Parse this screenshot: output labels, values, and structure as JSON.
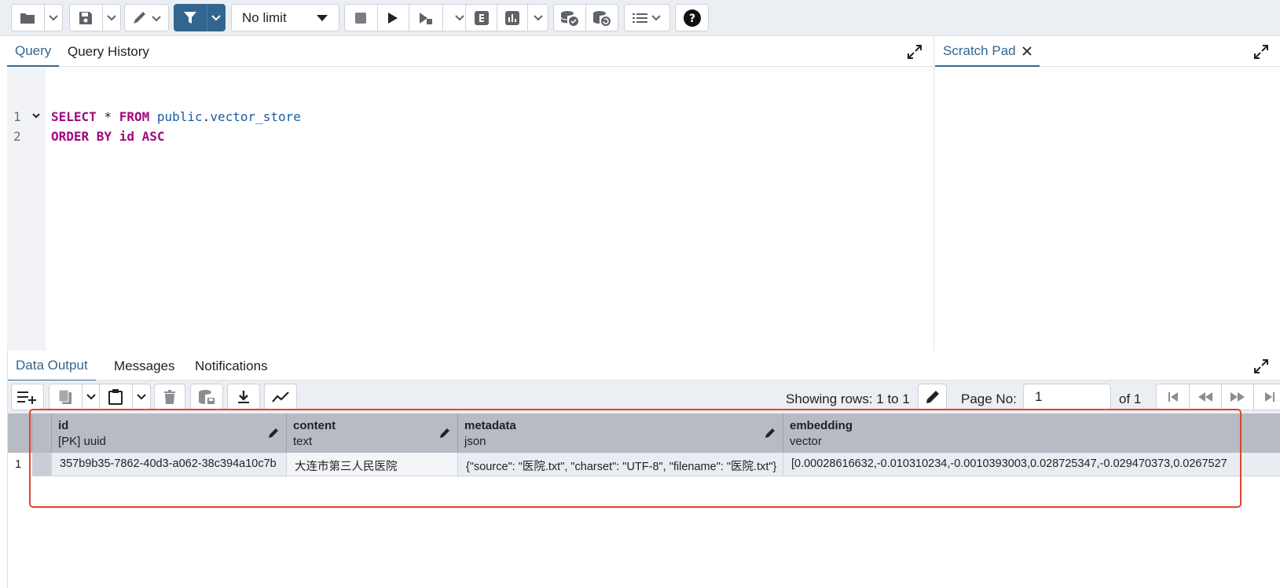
{
  "toolbar": {
    "limit_value": "No limit",
    "icons": [
      "folder-icon",
      "save-icon",
      "pen-icon",
      "filter-icon",
      "stop-icon",
      "play-icon",
      "explain-icon",
      "explain-analyze-icon",
      "commit-icon",
      "rollback-icon",
      "macros-icon",
      "help-icon"
    ],
    "accent": "#326690"
  },
  "editor": {
    "tabs": [
      {
        "label": "Query"
      },
      {
        "label": "Query History"
      }
    ],
    "line_numbers": [
      "1",
      "2"
    ],
    "lines": [
      {
        "kw1": "SELECT",
        "op": " * ",
        "kw2": "FROM",
        "schema": " public",
        "dot": ".",
        "table": "vector_store"
      },
      {
        "kw1": "ORDER BY",
        "col": " id ",
        "kw2": "ASC"
      }
    ]
  },
  "scratch": {
    "tab_label": "Scratch Pad"
  },
  "output": {
    "tabs": [
      {
        "label": "Data Output"
      },
      {
        "label": "Messages"
      },
      {
        "label": "Notifications"
      }
    ],
    "showing_rows": "Showing rows: 1 to 1",
    "page_label": "Page No:",
    "page_value": "1",
    "of_label": "of 1",
    "columns": [
      {
        "name": "id",
        "type": "[PK] uuid"
      },
      {
        "name": "content",
        "type": "text"
      },
      {
        "name": "metadata",
        "type": "json"
      },
      {
        "name": "embedding",
        "type": "vector"
      }
    ],
    "rows": [
      {
        "num": "1",
        "id": "357b9b35-7862-40d3-a062-38c394a10c7b",
        "content": "大连市第三人民医院",
        "metadata": "{\"source\": \"医院.txt\", \"charset\": \"UTF-8\", \"filename\": \"医院.txt\"}",
        "embedding": "[0.00028616632,-0.010310234,-0.0010393003,0.028725347,-0.029470373,0.0267527"
      }
    ]
  },
  "highlight_color": "#e0432f"
}
